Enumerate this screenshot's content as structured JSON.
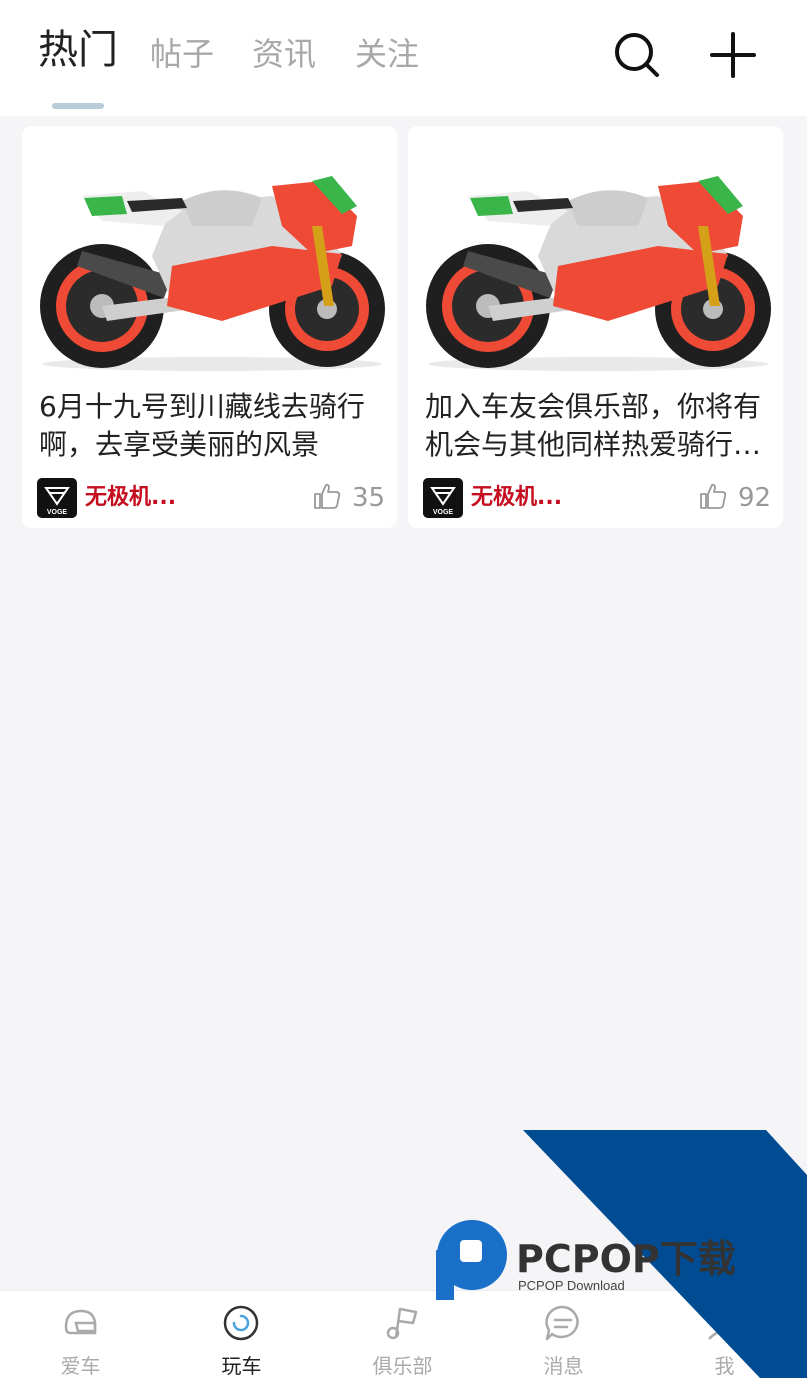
{
  "header": {
    "tabs": [
      {
        "label": "热门",
        "active": true
      },
      {
        "label": "帖子",
        "active": false
      },
      {
        "label": "资讯",
        "active": false
      },
      {
        "label": "关注",
        "active": false
      }
    ],
    "icons": [
      "search-icon",
      "plus-icon"
    ]
  },
  "feed": {
    "cards": [
      {
        "title": "6月十九号到川藏线去骑行啊，去享受美丽的风景",
        "author": "无极机...",
        "author_logo_text": "VOGE",
        "likes": "35",
        "image": "aprilia racing motorcycle"
      },
      {
        "title": "加入车友会俱乐部，你将有机会与其他同样热爱骑行的朋友",
        "author": "无极机...",
        "author_logo_text": "VOGE",
        "likes": "92",
        "image": "aprilia racing motorcycle"
      }
    ]
  },
  "watermark": {
    "brand": "PCPOP下载",
    "sub": "PCPOP Download",
    "colors": {
      "band": "#004c93",
      "logo": "#1a6fc9",
      "text": "#333333"
    }
  },
  "bottom_nav": {
    "items": [
      {
        "label": "爱车",
        "icon": "helmet-icon",
        "active": false
      },
      {
        "label": "玩车",
        "icon": "wheel-icon",
        "active": true
      },
      {
        "label": "俱乐部",
        "icon": "flag-icon",
        "active": false
      },
      {
        "label": "消息",
        "icon": "chat-icon",
        "active": false
      },
      {
        "label": "我",
        "icon": "person-icon",
        "active": false
      }
    ]
  },
  "colors": {
    "accent_red": "#c40d1e",
    "indicator": "#b9cdd9",
    "background": "#f5f5f8"
  }
}
